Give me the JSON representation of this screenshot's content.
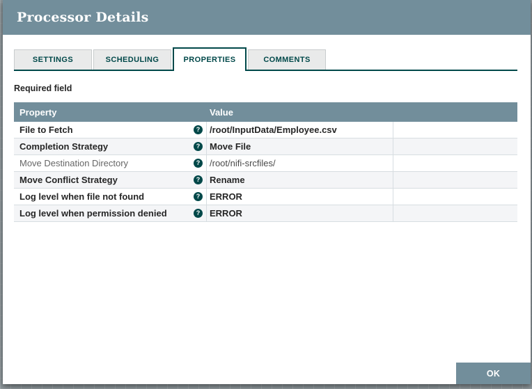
{
  "dialog": {
    "title": "Processor Details"
  },
  "tabs": [
    {
      "label": "SETTINGS",
      "active": false
    },
    {
      "label": "SCHEDULING",
      "active": false
    },
    {
      "label": "PROPERTIES",
      "active": true
    },
    {
      "label": "COMMENTS",
      "active": false
    }
  ],
  "required_field_label": "Required field",
  "table": {
    "columns": [
      "Property",
      "Value"
    ],
    "rows": [
      {
        "property": "File to Fetch",
        "value": "/root/InputData/Employee.csv",
        "required": true
      },
      {
        "property": "Completion Strategy",
        "value": "Move File",
        "required": true
      },
      {
        "property": "Move Destination Directory",
        "value": "/root/nifi-srcfiles/",
        "required": false
      },
      {
        "property": "Move Conflict Strategy",
        "value": "Rename",
        "required": true
      },
      {
        "property": "Log level when file not found",
        "value": "ERROR",
        "required": true
      },
      {
        "property": "Log level when permission denied",
        "value": "ERROR",
        "required": true
      }
    ]
  },
  "footer": {
    "ok_label": "OK"
  },
  "icons": {
    "help_glyph": "?"
  },
  "colors": {
    "header_bg": "#728E9B",
    "accent": "#004849",
    "row_alt_bg": "#F4F5F7",
    "row_border": "#D7DDE1",
    "canvas_bg": "#8F989C",
    "text_dark": "#262626"
  }
}
